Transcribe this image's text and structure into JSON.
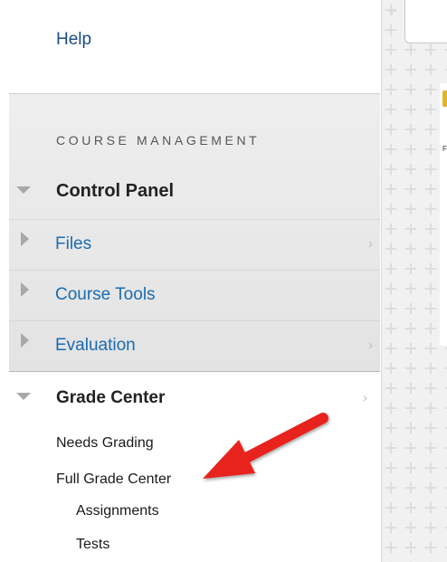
{
  "sidebar": {
    "help_label": "Help",
    "course_management_heading": "COURSE MANAGEMENT",
    "control_panel_label": "Control Panel",
    "items": [
      {
        "label": "Files",
        "chevron": "›"
      },
      {
        "label": "Course Tools",
        "chevron": ""
      },
      {
        "label": "Evaluation",
        "chevron": "›"
      }
    ],
    "grade_center": {
      "label": "Grade Center",
      "chevron": "›",
      "links": [
        {
          "label": "Needs Grading"
        },
        {
          "label": "Full Grade Center"
        },
        {
          "label": "Assignments"
        },
        {
          "label": "Tests"
        }
      ]
    }
  },
  "content": {
    "logo_letter": "F"
  },
  "colors": {
    "link_blue": "#1a6bb0",
    "annotation_arrow": "#e8201c",
    "logo_gold": "#e0b52a"
  },
  "icons": {
    "expanded": "triangle-down-icon",
    "collapsed": "triangle-right-icon",
    "chevron": "chevron-right-icon",
    "annotation": "red-arrow-annotation"
  }
}
